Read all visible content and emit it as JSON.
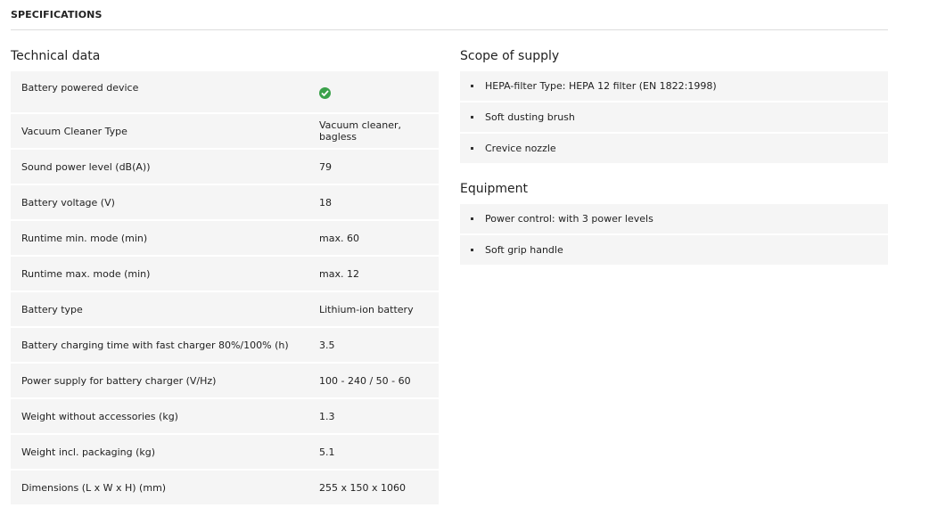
{
  "section_title": "SPECIFICATIONS",
  "technical": {
    "heading": "Technical data",
    "rows": [
      {
        "label": "Battery powered device",
        "value": "",
        "icon": "check-circle-icon"
      },
      {
        "label": "Vacuum Cleaner Type",
        "value": "Vacuum cleaner, bagless"
      },
      {
        "label": "Sound power level (dB(A))",
        "value": "79"
      },
      {
        "label": "Battery voltage (V)",
        "value": "18"
      },
      {
        "label": "Runtime min. mode (min)",
        "value": "max. 60"
      },
      {
        "label": "Runtime max. mode (min)",
        "value": "max. 12"
      },
      {
        "label": "Battery type",
        "value": "Lithium-ion battery"
      },
      {
        "label": "Battery charging time with fast charger 80%/100% (h)",
        "value": "3.5"
      },
      {
        "label": "Power supply for battery charger (V/Hz)",
        "value": "100 - 240 / 50 - 60"
      },
      {
        "label": "Weight without accessories (kg)",
        "value": "1.3"
      },
      {
        "label": "Weight incl. packaging (kg)",
        "value": "5.1"
      },
      {
        "label": "Dimensions (L x W x H) (mm)",
        "value": "255 x 150 x 1060"
      }
    ]
  },
  "scope": {
    "heading": "Scope of supply",
    "items": [
      "HEPA-filter Type: HEPA 12 filter (EN 1822:1998)",
      "Soft dusting brush",
      "Crevice nozzle"
    ]
  },
  "equipment": {
    "heading": "Equipment",
    "items": [
      "Power control: with 3 power levels",
      "Soft grip handle"
    ]
  },
  "colors": {
    "check": "#3aa14a",
    "row_bg": "#f5f5f5",
    "divider": "#dddddd"
  }
}
